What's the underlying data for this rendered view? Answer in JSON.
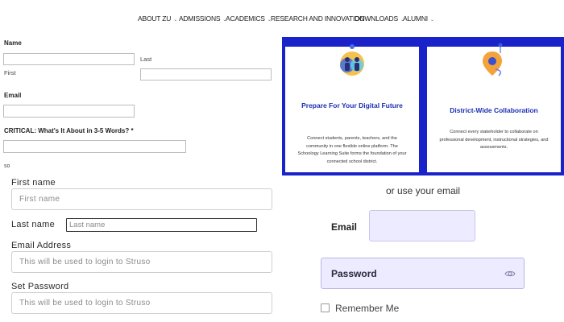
{
  "nav": {
    "items": [
      {
        "label": "ABOUT ZU"
      },
      {
        "label": "ADMISSIONS"
      },
      {
        "label": "ACADEMICS"
      },
      {
        "label": "RESEARCH AND INNOVATION"
      },
      {
        "label": "DOWNLOADS"
      },
      {
        "label": "ALUMNI"
      }
    ]
  },
  "form1": {
    "name_label": "Name",
    "first_sub": "First",
    "last_sub": "Last",
    "email_label": "Email",
    "critical_label": "CRITICAL: What's It About in 3-5 Words? *",
    "footer_text": "so"
  },
  "cards": [
    {
      "title": "Prepare For Your Digital Future",
      "desc": "Connect students, parents, teachers, and the community in one flexible online platform. The Schoology Learning Suite forms the foundation of your connected school district.",
      "icon": "people-circle-icon"
    },
    {
      "title": "District-Wide Collaboration",
      "desc": "Connect every stakeholder to collaborate on professional development, instructional strategies, and assessments.",
      "icon": "map-pin-icon"
    }
  ],
  "form2": {
    "first_label": "First name",
    "first_placeholder": "First name",
    "last_label": "Last name",
    "last_placeholder": "Last name",
    "email_label": "Email Address",
    "email_placeholder": "This will be used to login to Struso",
    "password_label": "Set Password",
    "password_placeholder": "This will be used to login to Struso"
  },
  "login": {
    "or_text": "or use your email",
    "email_label": "Email",
    "password_label": "Password",
    "remember_label": "Remember Me"
  },
  "colors": {
    "panel_blue": "#1a23c9",
    "card_title_blue": "#1b2fb5",
    "input_lavender": "#ecebff"
  }
}
